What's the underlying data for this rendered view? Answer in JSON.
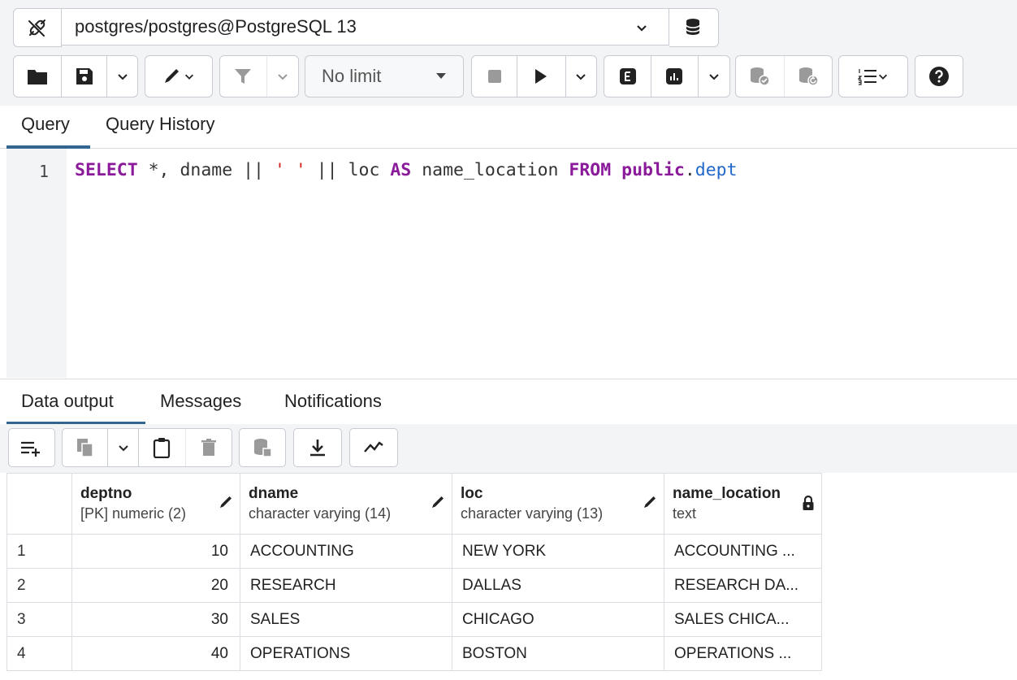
{
  "connection": {
    "label": "postgres/postgres@PostgreSQL 13"
  },
  "toolbar": {
    "limit_label": "No limit"
  },
  "query_tabs": [
    {
      "label": "Query"
    },
    {
      "label": "Query History"
    }
  ],
  "editor": {
    "line_number": "1",
    "tokens": {
      "select": "SELECT",
      "t1": " *, dname || ",
      "str": "' '",
      "t2": " || loc ",
      "as": "AS",
      "t3": " name_location ",
      "from": "FROM",
      "sp": " ",
      "schema": "public",
      "dot": ".",
      "table": "dept"
    }
  },
  "output_tabs": [
    {
      "label": "Data output"
    },
    {
      "label": "Messages"
    },
    {
      "label": "Notifications"
    }
  ],
  "grid": {
    "columns": [
      {
        "name": "deptno",
        "type": "[PK] numeric (2)"
      },
      {
        "name": "dname",
        "type": "character varying (14)"
      },
      {
        "name": "loc",
        "type": "character varying (13)"
      },
      {
        "name": "name_location",
        "type": "text"
      }
    ],
    "rows": [
      {
        "n": "1",
        "deptno": "10",
        "dname": "ACCOUNTING",
        "loc": "NEW YORK",
        "name_location": "ACCOUNTING ..."
      },
      {
        "n": "2",
        "deptno": "20",
        "dname": "RESEARCH",
        "loc": "DALLAS",
        "name_location": "RESEARCH DA..."
      },
      {
        "n": "3",
        "deptno": "30",
        "dname": "SALES",
        "loc": "CHICAGO",
        "name_location": "SALES CHICA..."
      },
      {
        "n": "4",
        "deptno": "40",
        "dname": "OPERATIONS",
        "loc": "BOSTON",
        "name_location": "OPERATIONS ..."
      }
    ]
  },
  "colors": {
    "accent": "#326690",
    "keyword": "#8b1a9b",
    "string": "#d41c1c",
    "identifier": "#2267c9"
  }
}
